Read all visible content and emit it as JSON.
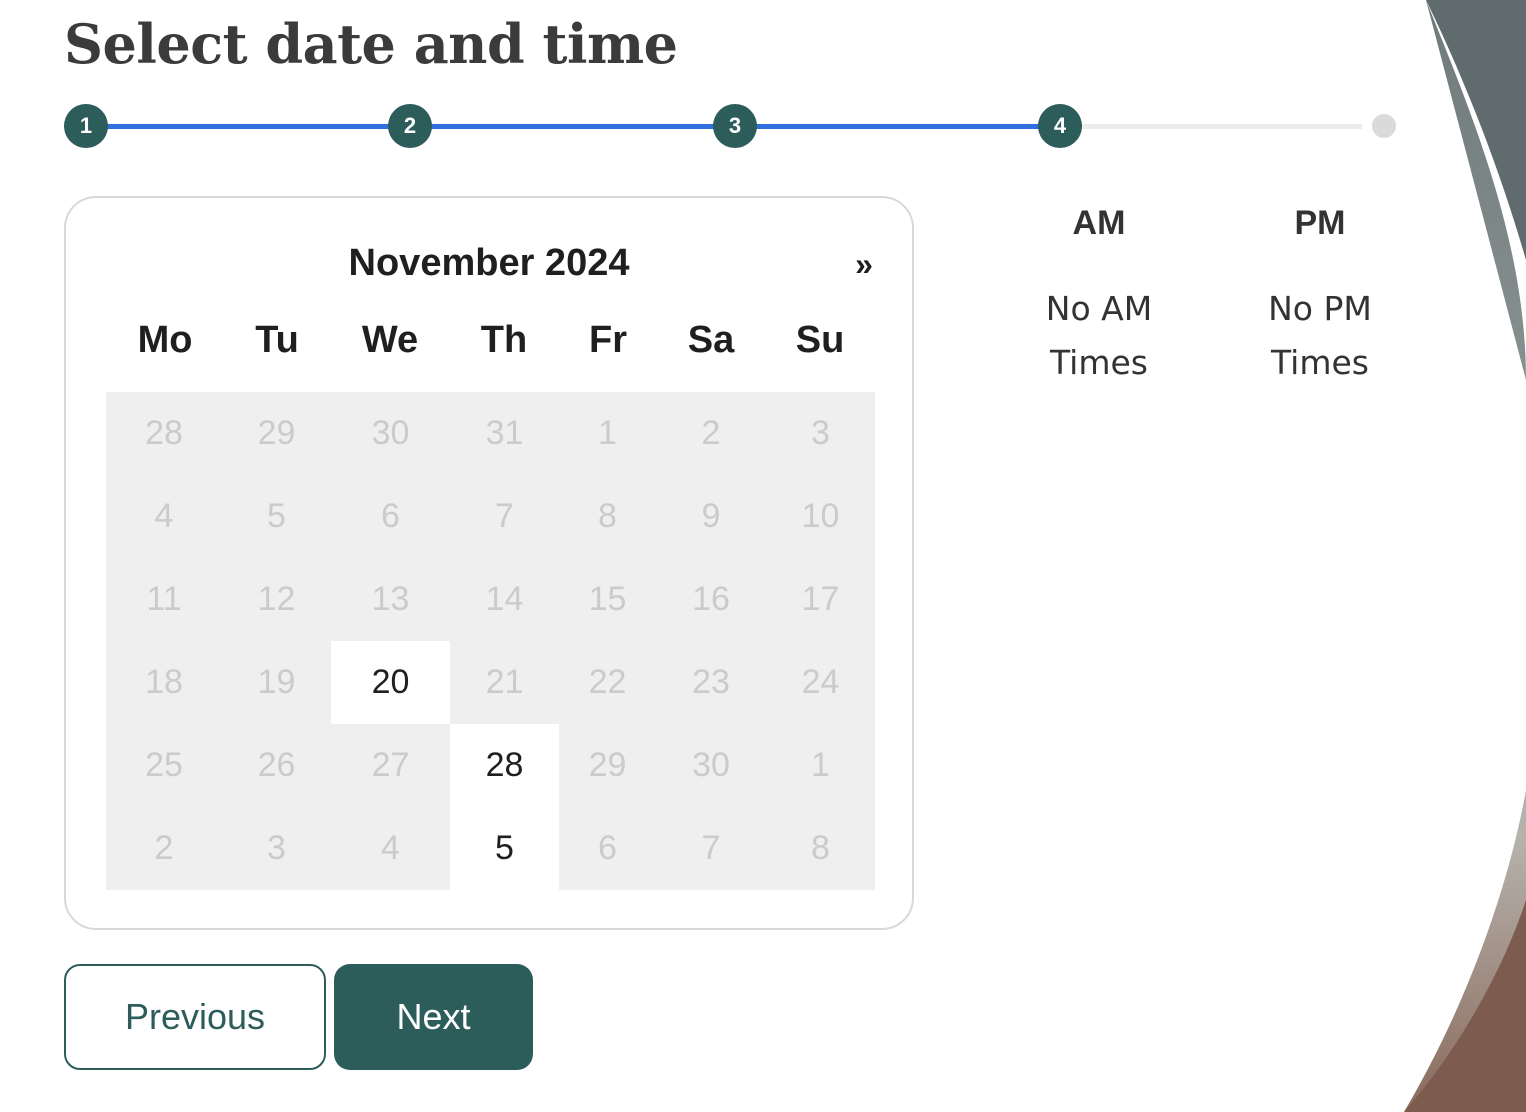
{
  "page": {
    "title": "Select date and time"
  },
  "stepper": {
    "steps": [
      "1",
      "2",
      "3",
      "4"
    ],
    "current_step": 4,
    "accent_color": "#2f6fe0",
    "step_color": "#2d5d5b"
  },
  "calendar": {
    "month_label": "November 2024",
    "next_label": "»",
    "weekdays": [
      "Mo",
      "Tu",
      "We",
      "Th",
      "Fr",
      "Sa",
      "Su"
    ],
    "weeks": [
      [
        {
          "d": "28",
          "a": false
        },
        {
          "d": "29",
          "a": false
        },
        {
          "d": "30",
          "a": false
        },
        {
          "d": "31",
          "a": false
        },
        {
          "d": "1",
          "a": false
        },
        {
          "d": "2",
          "a": false
        },
        {
          "d": "3",
          "a": false
        }
      ],
      [
        {
          "d": "4",
          "a": false
        },
        {
          "d": "5",
          "a": false
        },
        {
          "d": "6",
          "a": false
        },
        {
          "d": "7",
          "a": false
        },
        {
          "d": "8",
          "a": false
        },
        {
          "d": "9",
          "a": false
        },
        {
          "d": "10",
          "a": false
        }
      ],
      [
        {
          "d": "11",
          "a": false
        },
        {
          "d": "12",
          "a": false
        },
        {
          "d": "13",
          "a": false
        },
        {
          "d": "14",
          "a": false
        },
        {
          "d": "15",
          "a": false
        },
        {
          "d": "16",
          "a": false
        },
        {
          "d": "17",
          "a": false
        }
      ],
      [
        {
          "d": "18",
          "a": false
        },
        {
          "d": "19",
          "a": false
        },
        {
          "d": "20",
          "a": true
        },
        {
          "d": "21",
          "a": false
        },
        {
          "d": "22",
          "a": false
        },
        {
          "d": "23",
          "a": false
        },
        {
          "d": "24",
          "a": false
        }
      ],
      [
        {
          "d": "25",
          "a": false
        },
        {
          "d": "26",
          "a": false
        },
        {
          "d": "27",
          "a": false
        },
        {
          "d": "28",
          "a": true
        },
        {
          "d": "29",
          "a": false
        },
        {
          "d": "30",
          "a": false
        },
        {
          "d": "1",
          "a": false
        }
      ],
      [
        {
          "d": "2",
          "a": false
        },
        {
          "d": "3",
          "a": false
        },
        {
          "d": "4",
          "a": false
        },
        {
          "d": "5",
          "a": true
        },
        {
          "d": "6",
          "a": false
        },
        {
          "d": "7",
          "a": false
        },
        {
          "d": "8",
          "a": false
        }
      ]
    ]
  },
  "times": {
    "am": {
      "label": "AM",
      "empty": "No AM Times"
    },
    "pm": {
      "label": "PM",
      "empty": "No PM Times"
    }
  },
  "actions": {
    "previous": "Previous",
    "next": "Next"
  }
}
